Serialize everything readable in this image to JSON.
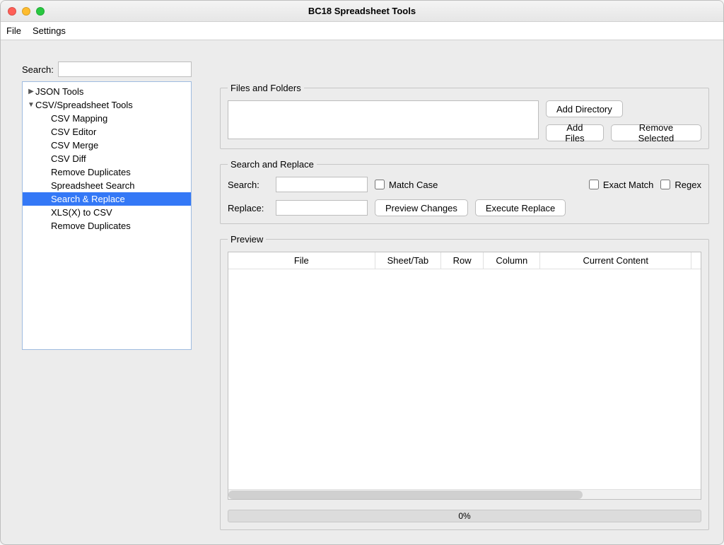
{
  "window": {
    "title": "BC18 Spreadsheet Tools"
  },
  "menubar": {
    "file": "File",
    "settings": "Settings"
  },
  "sidebar": {
    "search_label": "Search:",
    "search_value": "",
    "tree": {
      "json_tools": "JSON Tools",
      "csv_tools": "CSV/Spreadsheet Tools",
      "items": [
        "CSV Mapping",
        "CSV Editor",
        "CSV Merge",
        "CSV Diff",
        "Remove Duplicates",
        "Spreadsheet Search",
        "Search & Replace",
        "XLS(X) to CSV",
        "Remove Duplicates"
      ]
    }
  },
  "files_panel": {
    "legend": "Files and Folders",
    "add_directory": "Add Directory",
    "add_files": "Add Files",
    "remove_selected": "Remove Selected"
  },
  "sr_panel": {
    "legend": "Search and Replace",
    "search_label": "Search:",
    "search_value": "",
    "replace_label": "Replace:",
    "replace_value": "",
    "match_case": "Match Case",
    "exact_match": "Exact Match",
    "regex": "Regex",
    "preview_changes": "Preview Changes",
    "execute_replace": "Execute Replace"
  },
  "preview_panel": {
    "legend": "Preview",
    "columns": [
      "File",
      "Sheet/Tab",
      "Row",
      "Column",
      "Current Content"
    ]
  },
  "progress": {
    "text": "0%"
  }
}
